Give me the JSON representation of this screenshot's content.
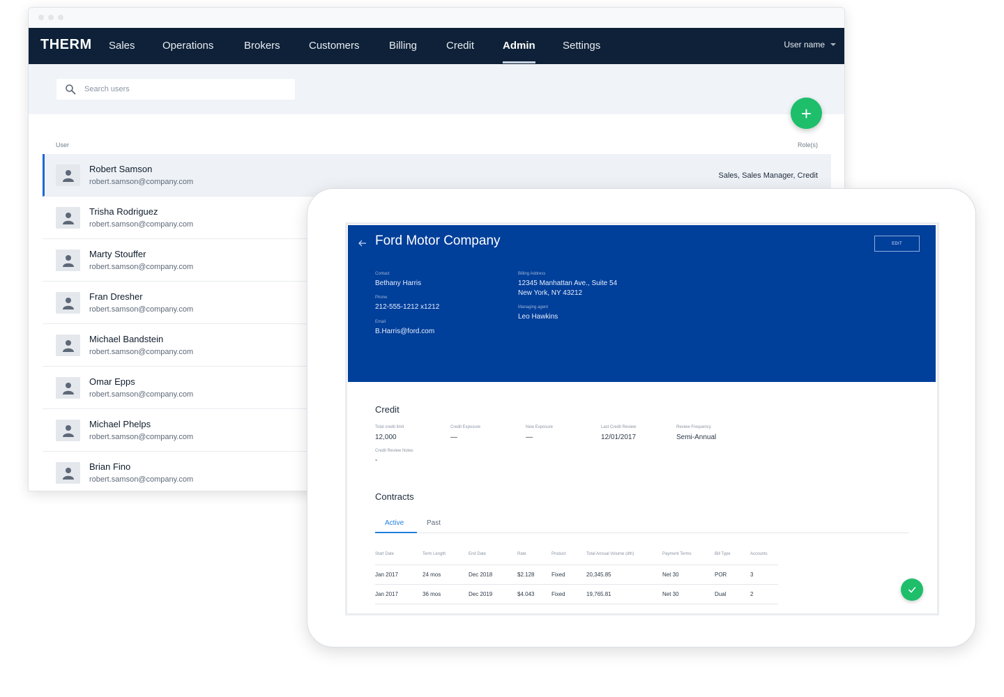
{
  "app": {
    "logo": "THERM",
    "nav": [
      "Sales",
      "Operations",
      "Brokers",
      "Customers",
      "Billing",
      "Credit",
      "Admin",
      "Settings"
    ],
    "active_nav": "Admin",
    "user_menu": "User name"
  },
  "search": {
    "placeholder": "Search users"
  },
  "list": {
    "col_user": "User",
    "col_roles": "Role(s)",
    "users": [
      {
        "name": "Robert Samson",
        "email": "robert.samson@company.com",
        "roles": "Sales, Sales Manager, Credit"
      },
      {
        "name": "Trisha Rodriguez",
        "email": "robert.samson@company.com"
      },
      {
        "name": "Marty Stouffer",
        "email": "robert.samson@company.com"
      },
      {
        "name": "Fran Dresher",
        "email": "robert.samson@company.com"
      },
      {
        "name": "Michael Bandstein",
        "email": "robert.samson@company.com"
      },
      {
        "name": "Omar Epps",
        "email": "robert.samson@company.com"
      },
      {
        "name": "Michael Phelps",
        "email": "robert.samson@company.com"
      },
      {
        "name": "Brian Fino",
        "email": "robert.samson@company.com"
      }
    ]
  },
  "detail": {
    "company": "Ford Motor Company",
    "edit_label": "EDIT",
    "contact_label": "Contact",
    "contact": "Bethany Harris",
    "phone_label": "Phone",
    "phone": "212-555-1212 x1212",
    "email_label": "Email",
    "email": "B.Harris@ford.com",
    "billing_label": "Billing Address",
    "billing_line1": "12345 Manhattan Ave., Suite 54",
    "billing_line2": "New York, NY 43212",
    "agent_label": "Managing agent",
    "agent": "Leo Hawkins",
    "credit": {
      "title": "Credit",
      "total_limit_label": "Total credit limit",
      "total_limit": "12,000",
      "exposure_label": "Credit Exposure",
      "exposure": "—",
      "new_exposure_label": "New Exposure",
      "new_exposure": "—",
      "last_review_label": "Last Credit Review",
      "last_review": "12/01/2017",
      "frequency_label": "Review Frequency",
      "frequency": "Semi-Annual",
      "notes_label": "Credit Review Notes",
      "notes": "-"
    },
    "contracts": {
      "title": "Contracts",
      "tab_active": "Active",
      "tab_past": "Past",
      "columns": [
        "Start Date",
        "Term Length",
        "End Date",
        "Rate",
        "Product",
        "Total Annual Volume (dth)",
        "Payment Terms",
        "Bill Type",
        "Accounts"
      ],
      "rows": [
        [
          "Jan 2017",
          "24 mos",
          "Dec 2018",
          "$2.128",
          "Fixed",
          "20,345.85",
          "Net 30",
          "POR",
          "3"
        ],
        [
          "Jan 2017",
          "36 mos",
          "Dec 2019",
          "$4.043",
          "Fixed",
          "19,765.81",
          "Net 30",
          "Dual",
          "2"
        ]
      ]
    }
  }
}
